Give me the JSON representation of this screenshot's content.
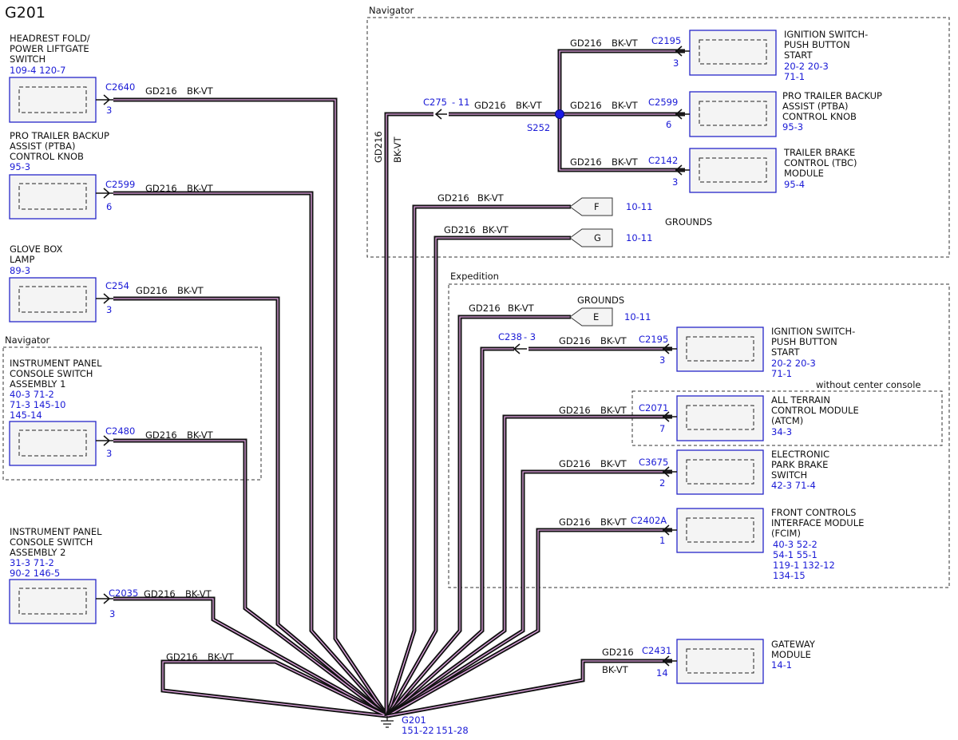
{
  "title": "G201",
  "wire": {
    "circuit": "GD216",
    "color": "BK-VT"
  },
  "regions": {
    "nav_top": "Navigator",
    "nav_left": "Navigator",
    "expedition": "Expedition",
    "center_console": "without center console"
  },
  "grounds_label": "GROUNDS",
  "ground": {
    "name": "G201",
    "refs": [
      "151-22",
      "151-28"
    ]
  },
  "splice": {
    "name": "S252"
  },
  "inline_connectors": [
    {
      "id": "c275",
      "name": "C275",
      "pin": "- 11"
    },
    {
      "id": "c238",
      "name": "C238",
      "pin": "- 3"
    }
  ],
  "flags": [
    {
      "id": "f",
      "letter": "F",
      "ref": "10-11"
    },
    {
      "id": "g",
      "letter": "G",
      "ref": "10-11"
    },
    {
      "id": "e",
      "letter": "E",
      "ref": "10-11"
    }
  ],
  "components": [
    {
      "id": "headrest",
      "lines": [
        "HEADREST FOLD/",
        "POWER LIFTGATE",
        "SWITCH"
      ],
      "refs": [
        "109-4  120-7"
      ],
      "connector": "C2640",
      "pin": "3"
    },
    {
      "id": "ptba-left",
      "lines": [
        "PRO TRAILER BACKUP",
        "ASSIST (PTBA)",
        "CONTROL KNOB"
      ],
      "refs": [
        "95-3"
      ],
      "connector": "C2599",
      "pin": "6"
    },
    {
      "id": "glovebox",
      "lines": [
        "GLOVE BOX",
        "LAMP"
      ],
      "refs": [
        "89-3"
      ],
      "connector": "C254",
      "pin": "3"
    },
    {
      "id": "ipcs1",
      "lines": [
        "INSTRUMENT PANEL",
        "CONSOLE SWITCH",
        "ASSEMBLY 1"
      ],
      "refs": [
        "40-3     71-2",
        "71-3      145-10",
        "145-14"
      ],
      "connector": "C2480",
      "pin": "3"
    },
    {
      "id": "ipcs2",
      "lines": [
        "INSTRUMENT PANEL",
        "CONSOLE SWITCH",
        "ASSEMBLY 2"
      ],
      "refs": [
        "31-3     71-2",
        "90-2     146-5"
      ],
      "connector": "C2035",
      "pin": "3"
    },
    {
      "id": "ign-nav",
      "lines": [
        "IGNITION SWITCH-",
        "PUSH BUTTON",
        "START"
      ],
      "refs": [
        "20-2     20-3",
        "71-1"
      ],
      "connector": "C2195",
      "pin": "3"
    },
    {
      "id": "ptba-nav",
      "lines": [
        "PRO TRAILER BACKUP",
        "ASSIST (PTBA)",
        "CONTROL KNOB"
      ],
      "refs": [
        "95-3"
      ],
      "connector": "C2599",
      "pin": "6"
    },
    {
      "id": "tbc",
      "lines": [
        "TRAILER BRAKE",
        "CONTROL (TBC)",
        "MODULE"
      ],
      "refs": [
        "95-4"
      ],
      "connector": "C2142",
      "pin": "3"
    },
    {
      "id": "ign-exp",
      "lines": [
        "IGNITION SWITCH-",
        "PUSH BUTTON",
        "START"
      ],
      "refs": [
        "20-2     20-3",
        "71-1"
      ],
      "connector": "C2195",
      "pin": "3"
    },
    {
      "id": "atcm",
      "lines": [
        "ALL TERRAIN",
        "CONTROL MODULE",
        "(ATCM)"
      ],
      "refs": [
        "34-3"
      ],
      "connector": "C2071",
      "pin": "7"
    },
    {
      "id": "epb",
      "lines": [
        "ELECTRONIC",
        "PARK BRAKE",
        "SWITCH"
      ],
      "refs": [
        "42-3     71-4"
      ],
      "connector": "C3675",
      "pin": "2"
    },
    {
      "id": "fcim",
      "lines": [
        "FRONT CONTROLS",
        "INTERFACE MODULE",
        "(FCIM)"
      ],
      "refs": [
        "40-3     52-2",
        "54-1     55-1",
        "119-1    132-12",
        "134-15"
      ],
      "connector": "C2402A",
      "pin": "1"
    },
    {
      "id": "gateway",
      "lines": [
        "GATEWAY",
        "MODULE"
      ],
      "refs": [
        "14-1"
      ],
      "connector": "C2431",
      "pin": "14"
    }
  ]
}
